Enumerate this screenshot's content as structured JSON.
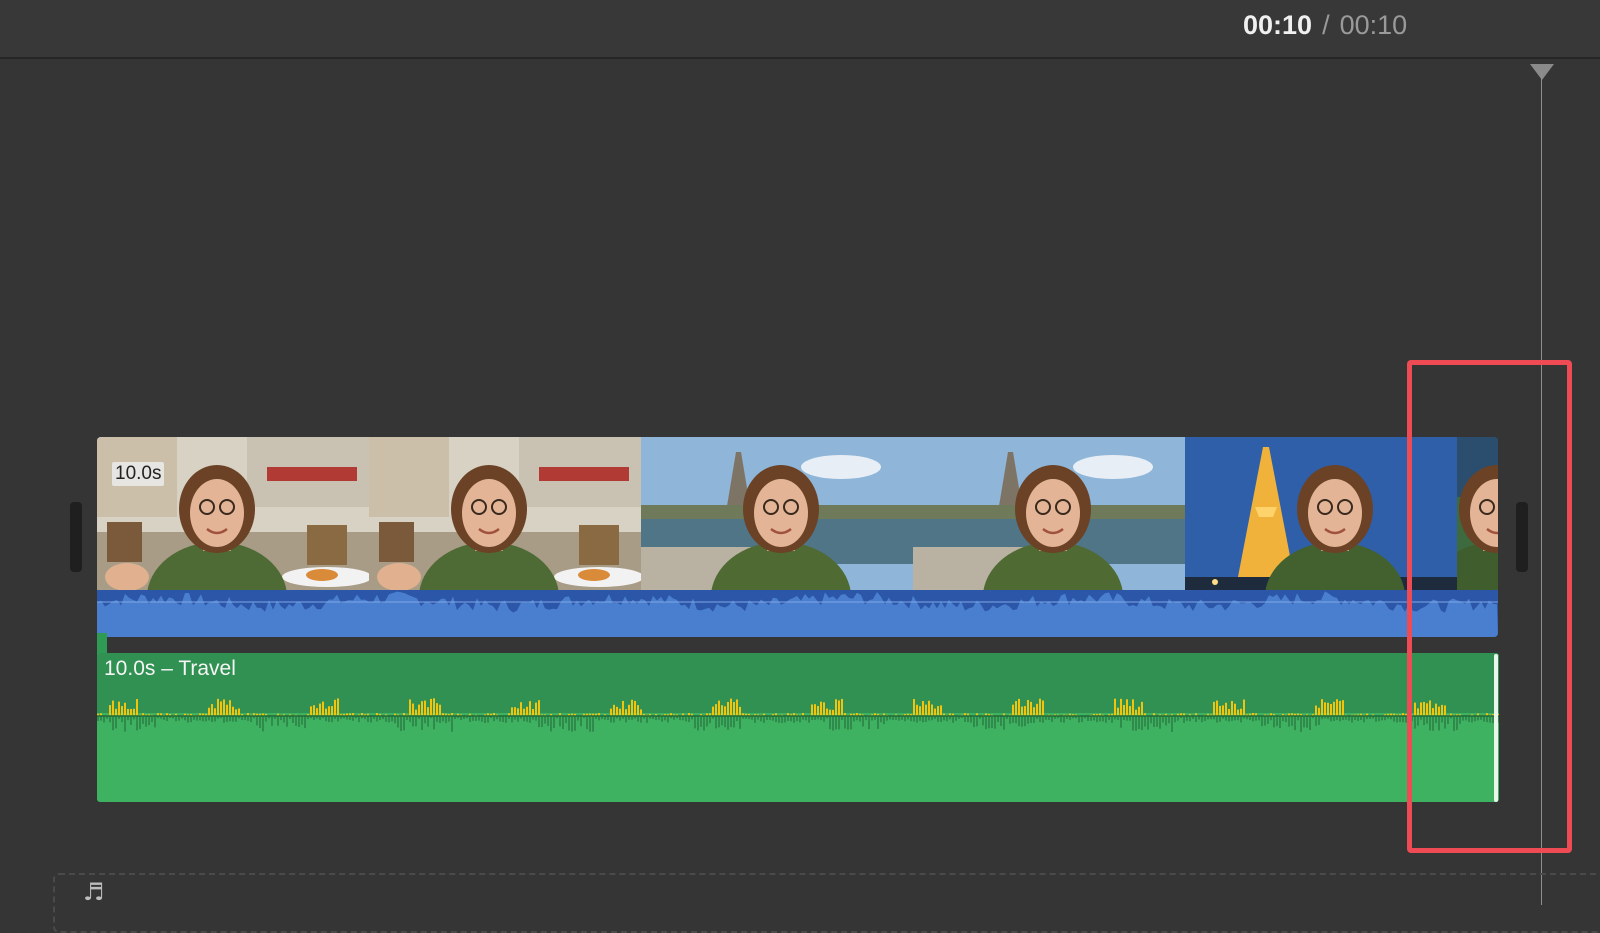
{
  "timecode": {
    "current": "00:10",
    "separator": "/",
    "total": "00:10"
  },
  "video_clip": {
    "duration_label": "10.0s",
    "frames": [
      {
        "scene": "cafe"
      },
      {
        "scene": "cafe"
      },
      {
        "scene": "seine"
      },
      {
        "scene": "seine"
      },
      {
        "scene": "eiffel-night"
      },
      {
        "scene": "portrait"
      }
    ]
  },
  "music_clip": {
    "label": "10.0s – Travel"
  },
  "background_track": {
    "icon": "music-note-icon",
    "glyph": "♬"
  },
  "colors": {
    "background": "#353535",
    "video_audio": "#2c56a8",
    "music_clip": "#3fb262",
    "waveform_peak": "#f1c40f",
    "highlight": "#ef4b55"
  }
}
